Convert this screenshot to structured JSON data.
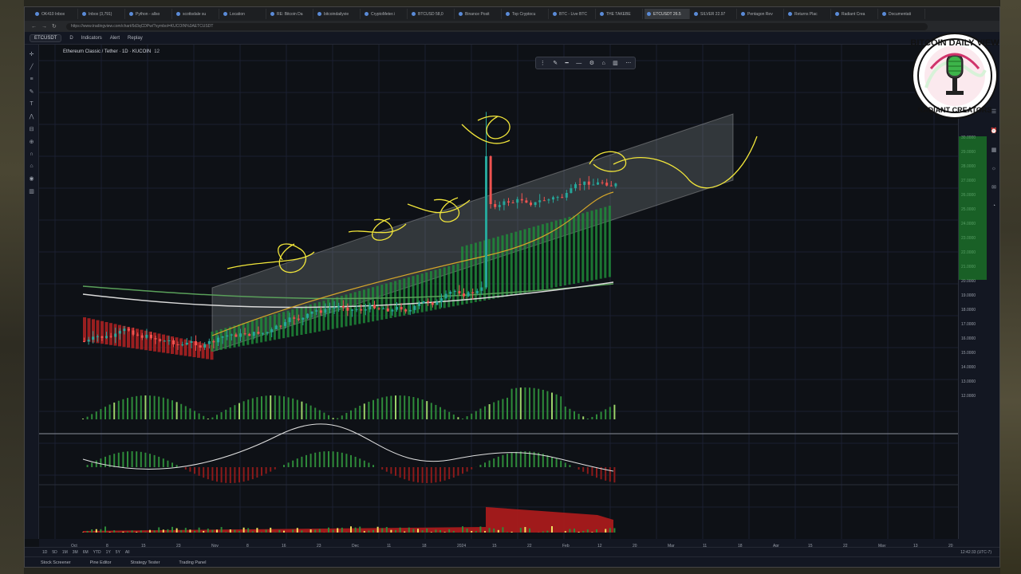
{
  "browser": {
    "tabs": [
      {
        "label": "OK410 Inbox"
      },
      {
        "label": "Inbox (3,791)"
      },
      {
        "label": "Python - allso"
      },
      {
        "label": "scottsdale su"
      },
      {
        "label": "Location"
      },
      {
        "label": "RE: Bitcoin Da"
      },
      {
        "label": "bitcoindailyvie"
      },
      {
        "label": "CryptoMeter.i"
      },
      {
        "label": "BTCUSD 58,0"
      },
      {
        "label": "Binance Posit"
      },
      {
        "label": "Top Cryptocu"
      },
      {
        "label": "BTC - Live BTC"
      },
      {
        "label": "THE TAKEBE"
      },
      {
        "label": "ETCUSDT 26.5"
      },
      {
        "label": "SILVER 22.97"
      },
      {
        "label": "Pentagon Rev"
      },
      {
        "label": "Returns Plac"
      },
      {
        "label": "Radiant Crea"
      },
      {
        "label": "Documentati"
      }
    ],
    "active_tab_index": 13,
    "url": "https://www.tradingview.com/chart/6d3qCDPw/?symbol=KUCOIN%3AETCUSDT"
  },
  "toolbar": {
    "symbol": "ETCUSDT",
    "timeframe": "D",
    "indicators": "Indicators",
    "alert": "Alert",
    "replay": "Replay"
  },
  "legend": {
    "title": "Ethereum Classic / Tether · 1D · KUCOIN",
    "sub": "12"
  },
  "price_labels": [
    "30.0000",
    "29.0000",
    "28.0000",
    "27.0000",
    "26.0000",
    "25.0000",
    "24.0000",
    "23.0000",
    "22.0000",
    "21.0000",
    "20.0000",
    "19.0000",
    "18.0000",
    "17.0000",
    "16.0000",
    "15.0000",
    "14.0000",
    "13.0000",
    "12.0000"
  ],
  "date_labels": [
    "Oct",
    "8",
    "15",
    "23",
    "Nov",
    "8",
    "16",
    "23",
    "Dec",
    "11",
    "18",
    "2024",
    "15",
    "22",
    "Feb",
    "12",
    "20",
    "Mar",
    "11",
    "18",
    "Apr",
    "15",
    "22",
    "May",
    "13",
    "20"
  ],
  "range_buttons": [
    "1D",
    "5D",
    "1M",
    "3M",
    "6M",
    "YTD",
    "1Y",
    "5Y",
    "All"
  ],
  "clock": "12:42:33 (UTC-7)",
  "bottom_tabs": [
    "Stock Screener",
    "Pine Editor",
    "Strategy Tester",
    "Trading Panel"
  ],
  "logo": {
    "top_text": "BITCOIN DAILY VIEW",
    "bottom_text": "RADIANT CREATORS"
  },
  "colors": {
    "bg": "#0e1116",
    "up": "#26a69a",
    "down": "#ef5350",
    "annotation": "#f2e63a"
  }
}
